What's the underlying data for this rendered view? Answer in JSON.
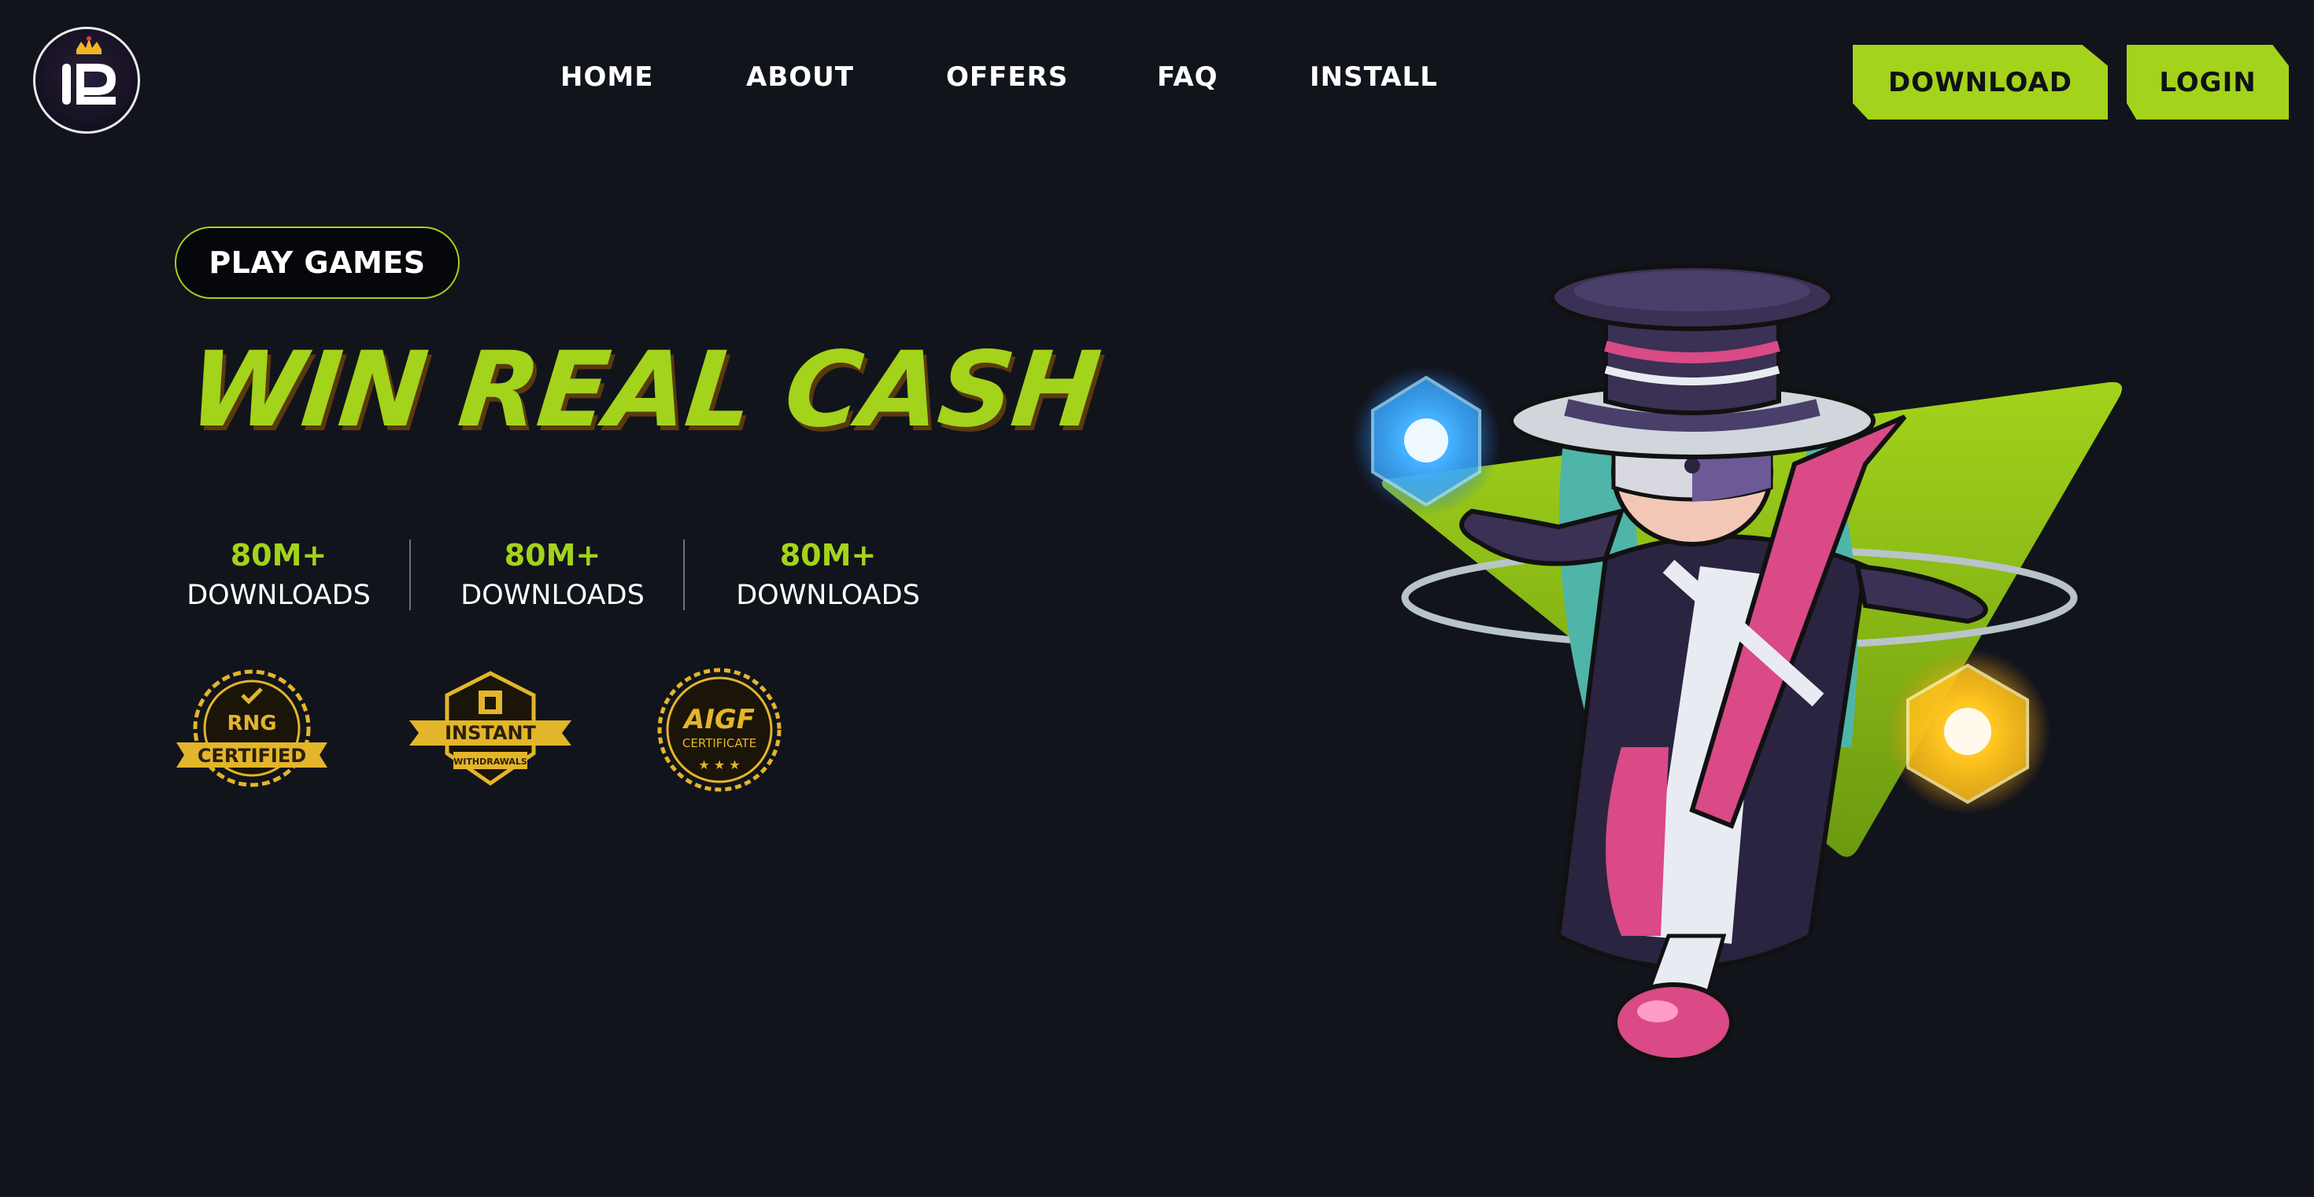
{
  "header": {
    "logo_icon": "lp-crown-logo",
    "nav": [
      {
        "label": "HOME"
      },
      {
        "label": "ABOUT"
      },
      {
        "label": "OFFERS"
      },
      {
        "label": "FAQ"
      },
      {
        "label": "INSTALL"
      }
    ],
    "download_label": "DOWNLOAD",
    "login_label": "LOGIN"
  },
  "hero": {
    "pill_label": "PLAY GAMES",
    "headline": "WIN REAL CASH",
    "stats": [
      {
        "value": "80M+",
        "label": "DOWNLOADS"
      },
      {
        "value": "80M+",
        "label": "DOWNLOADS"
      },
      {
        "value": "80M+",
        "label": "DOWNLOADS"
      }
    ],
    "badges": [
      {
        "icon": "rng-certified-badge",
        "line1": "RNG",
        "line2": "CERTIFIED"
      },
      {
        "icon": "instant-withdrawals-badge",
        "line1": "INSTANT",
        "line2": "WITHDRAWALS"
      },
      {
        "icon": "aigf-certificate-badge",
        "line1": "AIGF",
        "line2": "CERTIFICATE"
      }
    ],
    "art": "magician-character-illustration"
  },
  "colors": {
    "background": "#12141c",
    "accent": "#a3d31b",
    "badge_gold": "#e3b52a"
  }
}
